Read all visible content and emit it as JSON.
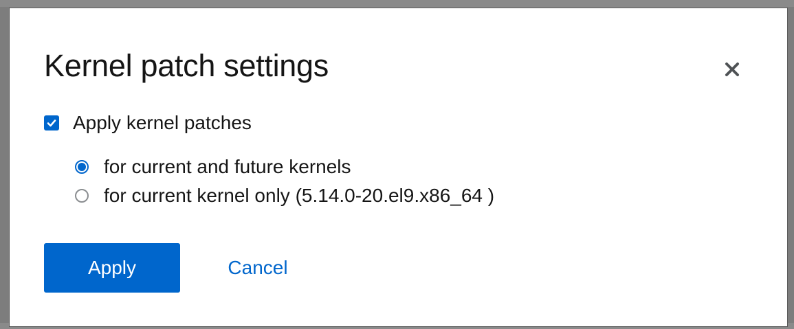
{
  "modal": {
    "title": "Kernel patch settings",
    "close_icon": "close-icon"
  },
  "checkbox": {
    "label": "Apply kernel patches",
    "checked": true
  },
  "radio_options": [
    {
      "label": "for current and future kernels",
      "selected": true
    },
    {
      "label": "for current kernel only (5.14.0-20.el9.x86_64 )",
      "selected": false
    }
  ],
  "buttons": {
    "apply_label": "Apply",
    "cancel_label": "Cancel"
  },
  "colors": {
    "accent": "#0066cc",
    "text": "#151515",
    "overlay": "#8a8a8a"
  }
}
